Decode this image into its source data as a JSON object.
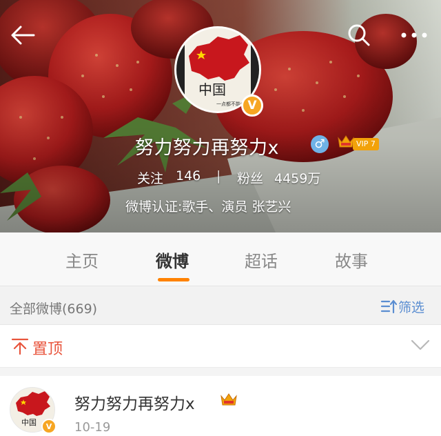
{
  "header": {
    "back_icon": "back-arrow-icon",
    "search_icon": "search-icon",
    "more_icon": "more-icon",
    "username": "努力努力再努力x",
    "gender_symbol": "♂",
    "vip_label": "VIP 7",
    "verified_symbol": "V",
    "avatar_text": "中国",
    "avatar_subtext": "一点都不能少",
    "following_label": "关注",
    "following_count": "146",
    "stats_separator": "|",
    "followers_label": "粉丝",
    "followers_count": "4459万",
    "verification": "微博认证:歌手、演员 张艺兴"
  },
  "tabs": [
    {
      "label": "主页",
      "active": false
    },
    {
      "label": "微博",
      "active": true
    },
    {
      "label": "超话",
      "active": false
    },
    {
      "label": "故事",
      "active": false
    }
  ],
  "filter_bar": {
    "all_label": "全部微博(669)",
    "filter_label": "筛选"
  },
  "pinned": {
    "label": "置顶"
  },
  "post": {
    "author": "努力努力再努力x",
    "date": "10-19"
  },
  "colors": {
    "accent_orange": "#ff8200",
    "filter_blue": "#5a8dd1",
    "pin_red": "#e8543c",
    "verified_gold": "#f6a623"
  }
}
